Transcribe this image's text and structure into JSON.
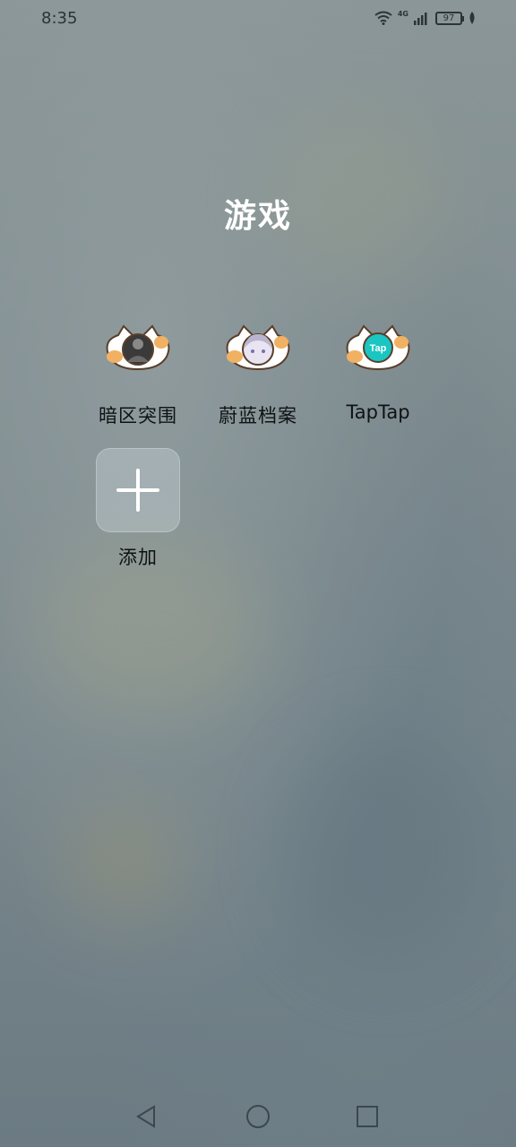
{
  "status_bar": {
    "time": "8:35",
    "network_label": "4G",
    "battery_level": "97",
    "icons": [
      "wifi-icon",
      "signal-icon",
      "battery-icon",
      "leaf-icon"
    ]
  },
  "folder": {
    "title": "游戏"
  },
  "apps": [
    {
      "label": "暗区突围",
      "icon": "game-avatar-soldier-icon"
    },
    {
      "label": "蔚蓝档案",
      "icon": "game-avatar-anime-girl-icon"
    },
    {
      "label": "TapTap",
      "icon": "taptap-icon",
      "icon_text": "Tap",
      "accent": "#19c6c2"
    }
  ],
  "add_button": {
    "label": "添加",
    "icon": "plus-icon"
  },
  "nav_bar": {
    "buttons": [
      "back-icon",
      "home-icon",
      "recents-icon"
    ]
  }
}
